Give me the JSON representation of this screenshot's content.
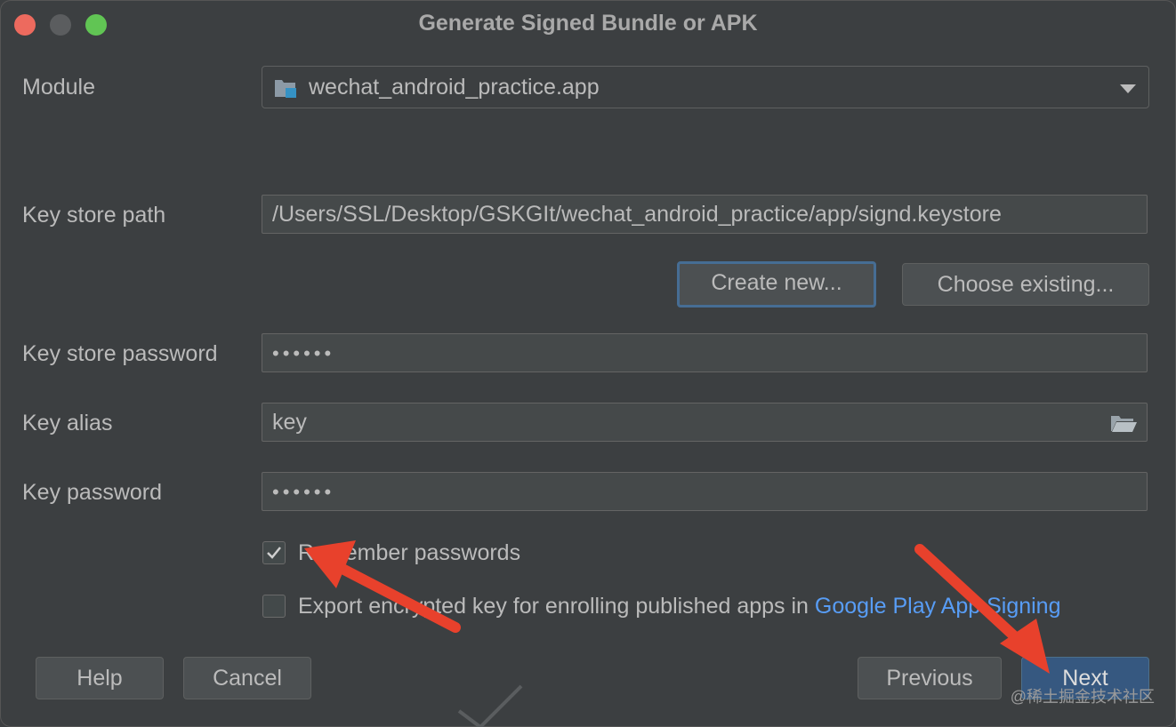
{
  "window": {
    "title": "Generate Signed Bundle or APK"
  },
  "form": {
    "module_label": "Module",
    "module_value": "wechat_android_practice.app",
    "keystore_path_label": "Key store path",
    "keystore_path_value": "/Users/SSL/Desktop/GSKGIt/wechat_android_practice/app/signd.keystore",
    "create_new_label": "Create new...",
    "choose_existing_label": "Choose existing...",
    "keystore_password_label": "Key store password",
    "keystore_password_value": "••••••",
    "key_alias_label": "Key alias",
    "key_alias_value": "key",
    "key_password_label": "Key password",
    "key_password_value": "••••••",
    "remember_passwords_label": "Remember passwords",
    "remember_passwords_checked": true,
    "export_key_label": "Export encrypted key for enrolling published apps in ",
    "export_key_link": "Google Play App Signing",
    "export_key_checked": false
  },
  "footer": {
    "help_label": "Help",
    "cancel_label": "Cancel",
    "previous_label": "Previous",
    "next_label": "Next"
  },
  "watermark": "@稀土掘金技术社区",
  "colors": {
    "accent": "#589df6",
    "primary_button": "#365880",
    "annotation_arrow": "#e8412c"
  }
}
